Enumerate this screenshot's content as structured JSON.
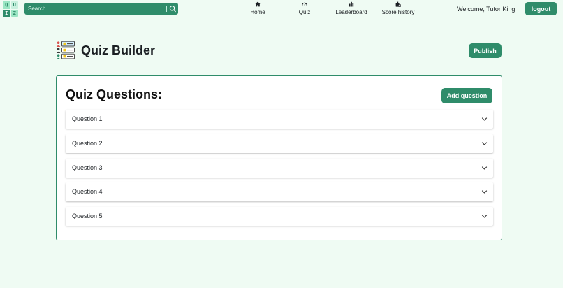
{
  "logo": {
    "letters": [
      "Q",
      "U",
      "I",
      "Z"
    ]
  },
  "search": {
    "placeholder": "Search"
  },
  "nav": {
    "items": [
      {
        "label": "Home",
        "icon": "home-icon"
      },
      {
        "label": "Quiz",
        "icon": "gauge-icon"
      },
      {
        "label": "Leaderboard",
        "icon": "bar-chart-icon"
      },
      {
        "label": "Score history",
        "icon": "score-history-icon"
      }
    ]
  },
  "user": {
    "welcome": "Welcome, Tutor King",
    "logout_label": "logout"
  },
  "header": {
    "title": "Quiz Builder",
    "publish_label": "Publish",
    "icon": "quiz-ranking-icon"
  },
  "panel": {
    "title": "Quiz Questions:",
    "add_label": "Add question",
    "questions": [
      {
        "label": "Question 1"
      },
      {
        "label": "Question 2"
      },
      {
        "label": "Question 3"
      },
      {
        "label": "Question 4"
      },
      {
        "label": "Question 5"
      }
    ]
  },
  "colors": {
    "brand": "#2f8c6a",
    "background": "#effbf3",
    "panel_border": "#2f8c6a"
  }
}
